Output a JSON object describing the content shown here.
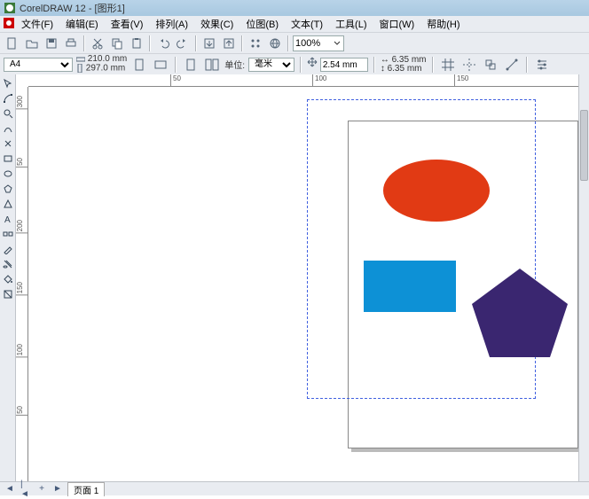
{
  "title": "CorelDRAW 12 - [图形1]",
  "menus": [
    "文件(F)",
    "编辑(E)",
    "查看(V)",
    "排列(A)",
    "效果(C)",
    "位图(B)",
    "文本(T)",
    "工具(L)",
    "窗口(W)",
    "帮助(H)"
  ],
  "toolbar": {
    "zoom": "100%"
  },
  "prop": {
    "paper": "A4",
    "width": "210.0 mm",
    "height": "297.0 mm",
    "units_label": "单位:",
    "units": "毫米",
    "nudge": "2.54 mm",
    "dup_x": "6.35 mm",
    "dup_y": "6.35 mm"
  },
  "rulers": {
    "h": [
      "50",
      "100",
      "150"
    ],
    "v": [
      "300",
      "50",
      "200",
      "150",
      "100",
      "50"
    ]
  },
  "status": {
    "page_tab": "页面 1"
  },
  "shapes": {
    "ellipse_color": "#e13a14",
    "rect_color": "#0d91d6",
    "pentagon_color": "#3a2670"
  }
}
